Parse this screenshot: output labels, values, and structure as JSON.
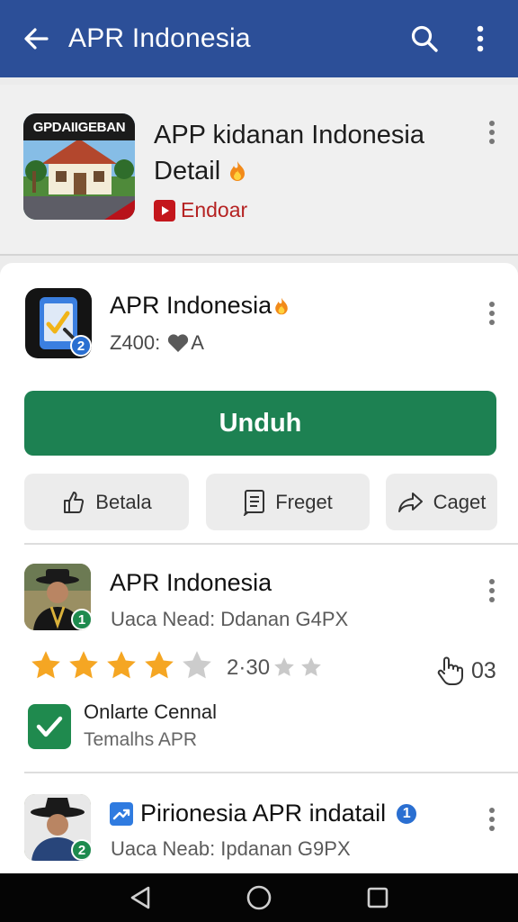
{
  "appbar": {
    "title": "APR Indonesia",
    "back_icon": "arrow-left-icon",
    "search_icon": "search-icon",
    "menu_icon": "more-vertical-icon",
    "color": "#2c4f98"
  },
  "featured": {
    "thumb_banner": "GPDAIIGEBAN",
    "title_line1": "APP kidanan Indonesia",
    "title_line2": "Detail",
    "channel": "Endoar"
  },
  "app": {
    "name": "APR Indonesia",
    "meta": "Z400:",
    "meta_suffix": "A",
    "icon_badge": "2",
    "install_label": "Unduh",
    "install_color": "#1d8152"
  },
  "actions": [
    {
      "label": "Betala",
      "icon": "thumbs-up-icon"
    },
    {
      "label": "Freget",
      "icon": "document-icon"
    },
    {
      "label": "Caget",
      "icon": "share-icon"
    }
  ],
  "review1": {
    "name": "APR Indonesia",
    "subtitle": "Uaca Nead: Ddanan G4PX",
    "badge": "1",
    "rating": 4,
    "rating_max": 5,
    "rating_text": "2·30",
    "likes": "03",
    "check_title": "Onlarte Cennal",
    "check_sub": "Temalhs APR"
  },
  "review2": {
    "name": "Pirionesia APR indatail",
    "subtitle": "Uaca Neab: Ipdanan G9PX",
    "badge": "2",
    "name_badge": "1"
  },
  "navbar": {
    "back": "nav-back-icon",
    "home": "nav-home-icon",
    "recents": "nav-recents-icon"
  }
}
